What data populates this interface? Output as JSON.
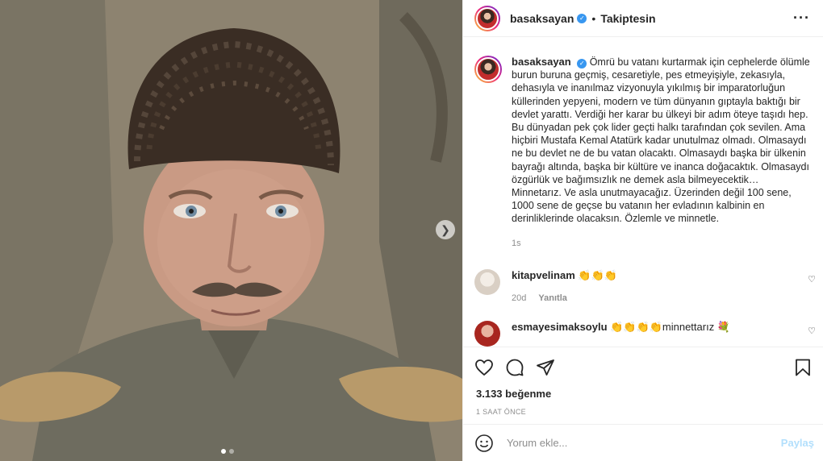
{
  "post": {
    "username": "basaksayan",
    "follow_status": "Takiptesin",
    "caption": "Ömrü bu vatanı kurtarmak için cephelerde ölümle burun buruna geçmiş, cesaretiyle, pes etmeyişiyle, zekasıyla, dehasıyla ve inanılmaz vizyonuyla yıkılmış bir imparatorluğun küllerinden yepyeni, modern ve tüm dünyanın gıptayla baktığı bir devlet yarattı. Verdiği her karar bu ülkeyi bir adım öteye taşıdı hep. Bu dünyadan pek çok lider geçti halkı tarafından çok sevilen. Ama hiçbiri Mustafa Kemal Atatürk kadar unutulmaz olmadı. Olmasaydı ne bu devlet ne de bu vatan olacaktı. Olmasaydı başka bir ülkenin bayrağı altında, başka bir kültüre ve inanca doğacaktık. Olmasaydı özgürlük ve bağımsızlık ne demek asla bilmeyecektik… Minnetarız. Ve asla unutmayacağız. Üzerinden değil 100 sene, 1000 sene de geçse bu vatanın her evladının kalbinin en derinliklerinde olacaksın. Özlemle ve minnetle.",
    "caption_time": "1s",
    "likes": "3.133 beğenme",
    "post_time": "1 SAAT ÖNCE"
  },
  "comments": [
    {
      "username": "kitapvelinam",
      "text": "👏👏👏",
      "time": "20d",
      "reply_label": "Yanıtla"
    },
    {
      "username": "esmayesimaksoylu",
      "text": "👏👏👏👏minnettarız 💐"
    }
  ],
  "add_comment": {
    "placeholder": "Yorum ekle...",
    "share_label": "Paylaş"
  },
  "carousel": {
    "total": 2,
    "current": 1
  },
  "colors": {
    "verified": "#3897f0",
    "share_disabled": "#b2dffc",
    "muted": "#8e8e8e"
  },
  "icons": [
    "verified-icon",
    "more-options-icon",
    "heart-icon",
    "comment-icon",
    "share-icon",
    "save-icon",
    "emoji-icon",
    "next-arrow-icon"
  ]
}
